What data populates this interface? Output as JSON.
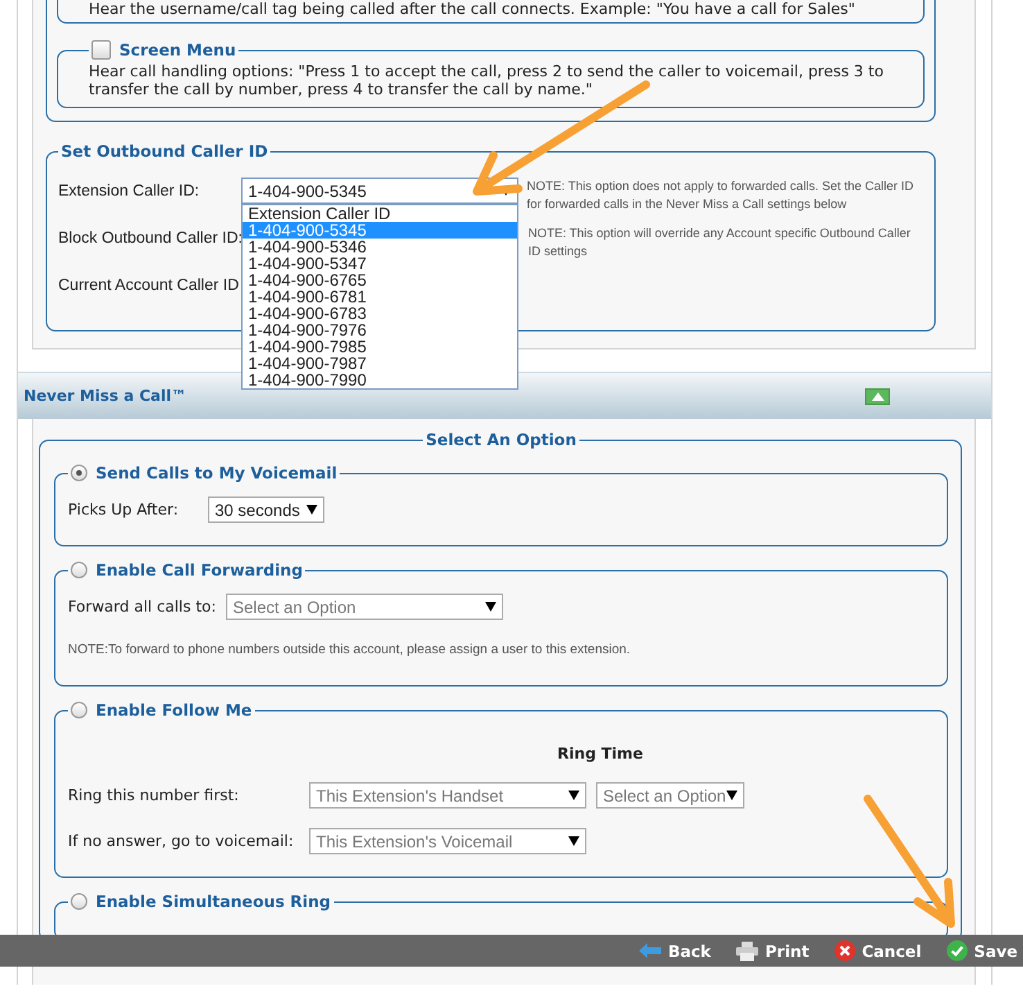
{
  "caller_tag_option": {
    "description": "Hear the username/call tag being called after the call connects. Example: \"You have a call for Sales\""
  },
  "screen_menu": {
    "label": "Screen Menu",
    "checked": false,
    "description": "Hear call handling options: \"Press 1 to accept the call, press 2 to send the caller to voicemail, press 3 to transfer the call by number, press 4 to transfer the call by name.\""
  },
  "outbound_caller_id": {
    "title": "Set Outbound Caller ID",
    "fields": [
      {
        "label": "Extension Caller ID:",
        "value": "1-404-900-5345",
        "note": "NOTE: This option does not apply to forwarded calls. Set the Caller ID for forwarded calls in the Never Miss a Call settings below"
      },
      {
        "label": "Block Outbound Caller ID:",
        "note": "NOTE: This option will override any Account specific Outbound Caller ID settings"
      },
      {
        "label": "Current Account Caller ID"
      }
    ],
    "dropdown_options": [
      {
        "text": "Extension Caller ID",
        "selected": false
      },
      {
        "text": "1-404-900-5345",
        "selected": true
      },
      {
        "text": "1-404-900-5346",
        "selected": false
      },
      {
        "text": "1-404-900-5347",
        "selected": false
      },
      {
        "text": "1-404-900-6765",
        "selected": false
      },
      {
        "text": "1-404-900-6781",
        "selected": false
      },
      {
        "text": "1-404-900-6783",
        "selected": false
      },
      {
        "text": "1-404-900-7976",
        "selected": false
      },
      {
        "text": "1-404-900-7985",
        "selected": false
      },
      {
        "text": "1-404-900-7987",
        "selected": false
      },
      {
        "text": "1-404-900-7990",
        "selected": false
      }
    ]
  },
  "never_miss_a_call": {
    "title": "Never Miss a Call™",
    "expanded": true,
    "group_title": "Select An Option",
    "options": [
      {
        "label": "Send Calls to My Voicemail",
        "selected": true,
        "rows": [
          {
            "label": "Picks Up After:",
            "selects": [
              {
                "value": "30 seconds",
                "disabled": false
              }
            ]
          }
        ]
      },
      {
        "label": "Enable Call Forwarding",
        "selected": false,
        "rows": [
          {
            "label": "Forward all calls to:",
            "selects": [
              {
                "value": "Select an Option",
                "disabled": true
              }
            ]
          }
        ],
        "note": "NOTE:To forward to phone numbers outside this account, please assign a user to this extension."
      },
      {
        "label": "Enable Follow Me",
        "selected": false,
        "column_heading": "Ring Time",
        "rows": [
          {
            "label": "Ring this number first:",
            "selects": [
              {
                "value": "This Extension's Handset",
                "disabled": true
              },
              {
                "value": "Select an Option",
                "disabled": true
              }
            ]
          },
          {
            "label": "If no answer, go to voicemail:",
            "selects": [
              {
                "value": "This Extension's Voicemail",
                "disabled": true
              }
            ]
          }
        ]
      },
      {
        "label": "Enable Simultaneous Ring",
        "selected": false
      }
    ]
  },
  "toolbar": {
    "buttons": [
      {
        "label": "Back",
        "kind": "back"
      },
      {
        "label": "Print",
        "kind": "print"
      },
      {
        "label": "Cancel",
        "kind": "cancel"
      },
      {
        "label": "Save",
        "kind": "save"
      }
    ]
  }
}
